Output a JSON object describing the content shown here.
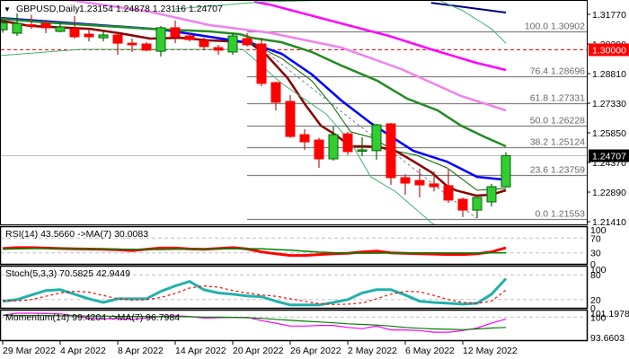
{
  "header": {
    "symbol": "GBPUSD,Daily",
    "ohlc": "1.23154 1.24878 1.23116 1.24707"
  },
  "chart_data": {
    "type": "candlestick",
    "title": "GBPUSD,Daily",
    "ohlc_readout": {
      "open": 1.23154,
      "high": 1.24878,
      "low": 1.23116,
      "close": 1.24707
    },
    "price_axis": {
      "ylim": [
        1.2137,
        1.3249
      ],
      "ticks": [
        "1.31770",
        "1.30290",
        "1.28810",
        "1.27330",
        "1.25850",
        "1.24370",
        "1.22890",
        "1.21410"
      ],
      "tick_values": [
        1.3177,
        1.3029,
        1.2881,
        1.2733,
        1.2585,
        1.2437,
        1.2289,
        1.2141
      ]
    },
    "current_price": {
      "value": 1.24707,
      "label": "1.24707",
      "color": "#000000"
    },
    "key_level": {
      "value": 1.3,
      "label": "1.30000",
      "color": "#FF0000"
    },
    "fibonacci": [
      {
        "label": "100.0 1.30902",
        "value": 1.30902
      },
      {
        "label": "76.4 1.28696",
        "value": 1.28696
      },
      {
        "label": "61.8 1.27331",
        "value": 1.27331
      },
      {
        "label": "50.0 1.26228",
        "value": 1.26228
      },
      {
        "label": "38.2 1.25124",
        "value": 1.25124
      },
      {
        "label": "23.6 1.23759",
        "value": 1.23759
      },
      {
        "label": "0.0 1.21553",
        "value": 1.21553
      }
    ],
    "x_labels": [
      {
        "label": "29 Mar 2022",
        "bar": 0
      },
      {
        "label": "4 Apr 2022",
        "bar": 4
      },
      {
        "label": "8 Apr 2022",
        "bar": 8
      },
      {
        "label": "14 Apr 2022",
        "bar": 12
      },
      {
        "label": "20 Apr 2022",
        "bar": 16
      },
      {
        "label": "26 Apr 2022",
        "bar": 20
      },
      {
        "label": "2 May 2022",
        "bar": 24
      },
      {
        "label": "6 May 2022",
        "bar": 28
      },
      {
        "label": "12 May 2022",
        "bar": 32
      }
    ],
    "candles": [
      [
        1.31,
        1.315,
        1.3085,
        1.3135
      ],
      [
        1.3083,
        1.3181,
        1.3069,
        1.3132
      ],
      [
        1.3125,
        1.3175,
        1.3105,
        1.312
      ],
      [
        1.3132,
        1.315,
        1.3083,
        1.311
      ],
      [
        1.3092,
        1.3137,
        1.3087,
        1.3114
      ],
      [
        1.3105,
        1.3168,
        1.3056,
        1.3065
      ],
      [
        1.3078,
        1.3101,
        1.3042,
        1.3065
      ],
      [
        1.306,
        1.3092,
        1.3042,
        1.3074
      ],
      [
        1.3074,
        1.3083,
        1.2975,
        1.3033
      ],
      [
        1.3033,
        1.3056,
        1.2989,
        1.3025
      ],
      [
        1.3029,
        1.3038,
        1.2993,
        1.2998
      ],
      [
        1.2993,
        1.3119,
        1.2966,
        1.311
      ],
      [
        1.311,
        1.3146,
        1.3033,
        1.3065
      ],
      [
        1.3069,
        1.3083,
        1.3042,
        1.3051
      ],
      [
        1.3047,
        1.306,
        1.2998,
        1.3016
      ],
      [
        1.3011,
        1.3025,
        1.2975,
        1.2998
      ],
      [
        1.2989,
        1.3083,
        1.2975,
        1.3069
      ],
      [
        1.3056,
        1.3083,
        1.3016,
        1.3025
      ],
      [
        1.3029,
        1.306,
        1.2818,
        1.2832
      ],
      [
        1.2836,
        1.284,
        1.2697,
        1.2738
      ],
      [
        1.2742,
        1.2773,
        1.256,
        1.2567
      ],
      [
        1.2576,
        1.2603,
        1.25,
        1.254
      ],
      [
        1.2549,
        1.256,
        1.241,
        1.2455
      ],
      [
        1.2455,
        1.2617,
        1.2446,
        1.2576
      ],
      [
        1.258,
        1.259,
        1.2475,
        1.2491
      ],
      [
        1.2496,
        1.2563,
        1.2468,
        1.25
      ],
      [
        1.2496,
        1.263,
        1.2451,
        1.2625
      ],
      [
        1.263,
        1.2634,
        1.2325,
        1.2361
      ],
      [
        1.2361,
        1.2379,
        1.2276,
        1.2334
      ],
      [
        1.2347,
        1.2406,
        1.2262,
        1.2325
      ],
      [
        1.233,
        1.2392,
        1.2293,
        1.2316
      ],
      [
        1.2321,
        1.2401,
        1.2235,
        1.2249
      ],
      [
        1.2253,
        1.2262,
        1.2164,
        1.2199
      ],
      [
        1.2199,
        1.2262,
        1.2159,
        1.2262
      ],
      [
        1.224,
        1.233,
        1.2217,
        1.2316
      ],
      [
        1.23154,
        1.24878,
        1.23116,
        1.24707
      ]
    ],
    "overlays": [
      {
        "name": "ma-fast-darkred",
        "color": "#8B0000",
        "width": 2.5,
        "points": [
          [
            -0.19,
            1.3146
          ],
          [
            1.87,
            1.3119
          ],
          [
            6.06,
            1.3105
          ],
          [
            8.13,
            1.3083
          ],
          [
            10.25,
            1.3056
          ],
          [
            12.31,
            1.306
          ],
          [
            14.38,
            1.3047
          ],
          [
            17.13,
            1.3038
          ],
          [
            18.38,
            1.2971
          ],
          [
            19.81,
            1.2859
          ],
          [
            21.06,
            1.2724
          ],
          [
            22.13,
            1.2621
          ],
          [
            23.13,
            1.2576
          ],
          [
            24.19,
            1.2518
          ],
          [
            25.25,
            1.2518
          ],
          [
            26.25,
            1.2513
          ],
          [
            27.31,
            1.2495
          ],
          [
            28.38,
            1.2451
          ],
          [
            29.81,
            1.2388
          ],
          [
            30.88,
            1.2321
          ],
          [
            31.5,
            1.2298
          ],
          [
            32.94,
            1.2271
          ],
          [
            34,
            1.2276
          ],
          [
            35,
            1.2298
          ]
        ]
      },
      {
        "name": "ma-blue",
        "color": "#0000FF",
        "width": 2.5,
        "points": [
          [
            -0.19,
            1.3159
          ],
          [
            4,
            1.3137
          ],
          [
            11.06,
            1.3101
          ],
          [
            17.3,
            1.3033
          ],
          [
            19.4,
            1.298
          ],
          [
            21.5,
            1.2877
          ],
          [
            23.56,
            1.2746
          ],
          [
            25.6,
            1.2634
          ],
          [
            27.1,
            1.2563
          ],
          [
            28.56,
            1.2495
          ],
          [
            30.9,
            1.2441
          ],
          [
            33,
            1.2365
          ],
          [
            34.8,
            1.2352
          ]
        ]
      },
      {
        "name": "ma-green",
        "color": "#228B22",
        "width": 2.5,
        "points": [
          [
            -0.19,
            1.3155
          ],
          [
            2.94,
            1.3137
          ],
          [
            6.06,
            1.3123
          ],
          [
            10.25,
            1.3105
          ],
          [
            14.38,
            1.3092
          ],
          [
            16.5,
            1.3078
          ],
          [
            17.31,
            1.306
          ],
          [
            19.38,
            1.3038
          ],
          [
            21.5,
            1.2989
          ],
          [
            23.56,
            1.2921
          ],
          [
            26.06,
            1.2845
          ],
          [
            28.13,
            1.2756
          ],
          [
            30.25,
            1.2697
          ],
          [
            31.88,
            1.2621
          ],
          [
            33.56,
            1.2563
          ],
          [
            35,
            1.2518
          ]
        ]
      },
      {
        "name": "ma-violet",
        "color": "#EE82EE",
        "width": 2.5,
        "points": [
          [
            -0.19,
            1.335
          ],
          [
            4.63,
            1.3249
          ],
          [
            10.25,
            1.319
          ],
          [
            14.38,
            1.3123
          ],
          [
            18.56,
            1.3085
          ],
          [
            23.56,
            1.3011
          ],
          [
            27.75,
            1.2903
          ],
          [
            31.88,
            1.2769
          ],
          [
            35,
            1.2697
          ]
        ]
      },
      {
        "name": "ma-magenta",
        "color": "#FF00FF",
        "width": 2.5,
        "points": [
          [
            17.5,
            1.324
          ],
          [
            18.56,
            1.3226
          ],
          [
            26.88,
            1.3069
          ],
          [
            29.81,
            1.3002
          ],
          [
            32.94,
            1.2935
          ],
          [
            35,
            1.2899
          ]
        ]
      },
      {
        "name": "ma-navy",
        "color": "#000080",
        "width": 2,
        "points": [
          [
            29.8,
            1.3235
          ],
          [
            35,
            1.3186
          ]
        ]
      },
      {
        "name": "ma-thin-green",
        "color": "#006400",
        "width": 1,
        "points": [
          [
            17.3,
            1.3033
          ],
          [
            19.4,
            1.2957
          ],
          [
            21.5,
            1.2845
          ],
          [
            22.9,
            1.2724
          ],
          [
            24.2,
            1.259
          ],
          [
            25.6,
            1.2563
          ],
          [
            27.3,
            1.2495
          ],
          [
            28.8,
            1.2473
          ],
          [
            30.9,
            1.241
          ],
          [
            33,
            1.2298
          ],
          [
            35,
            1.2307
          ]
        ]
      },
      {
        "name": "band-upper",
        "color": "#3CB371",
        "width": 1,
        "points": [
          [
            12,
            1.3204
          ],
          [
            18,
            1.324
          ],
          [
            30,
            1.326
          ],
          [
            32,
            1.3195
          ],
          [
            34,
            1.3105
          ],
          [
            35,
            1.3033
          ]
        ]
      },
      {
        "name": "band-lower",
        "color": "#3CB371",
        "width": 1,
        "points": [
          [
            -0.19,
            1.2971
          ],
          [
            5.4,
            1.3002
          ],
          [
            16.7,
            1.3002
          ],
          [
            17.3,
            1.2966
          ],
          [
            19.4,
            1.2832
          ],
          [
            22.5,
            1.2679
          ],
          [
            24.2,
            1.254
          ],
          [
            25.6,
            1.2365
          ],
          [
            27.3,
            1.2293
          ],
          [
            29.8,
            1.2137
          ],
          [
            31,
            1.208
          ]
        ]
      },
      {
        "name": "trend-dotted",
        "color": "#708090",
        "width": 1,
        "dash": "3,3",
        "points": [
          [
            17.3,
            1.3047
          ],
          [
            32.94,
            1.2159
          ]
        ]
      }
    ],
    "indicators": [
      {
        "name": "rsi",
        "label": "RSI(14) 43.5660  ->MA(7) 30.0083",
        "ylim": [
          0,
          100
        ],
        "levels": [
          70,
          30
        ],
        "ticks": [
          "100",
          "70",
          "30",
          "0"
        ],
        "tick_values": [
          100,
          70,
          30,
          0
        ],
        "series": [
          {
            "name": "RSI(14)",
            "color": "#FF0000",
            "width": 3,
            "values": [
              41.8,
              44.1,
              44.1,
              43,
              41.8,
              41,
              40.3,
              39.4,
              38.2,
              35.9,
              39.4,
              43,
              43,
              40.6,
              39.4,
              41.8,
              44.1,
              40.6,
              32.4,
              27.6,
              22.9,
              22.9,
              25.3,
              27.6,
              28.8,
              32.4,
              34.7,
              30,
              28.8,
              27.6,
              26.5,
              25.3,
              25.3,
              27.6,
              32.4,
              43.566
            ]
          },
          {
            "name": "MA(7)",
            "color": "#008000",
            "width": 1.5,
            "values": [
              40,
              41,
              41.5,
              42,
              42,
              41.5,
              41,
              40.5,
              40,
              39.5,
              39,
              39,
              39.5,
              40,
              40,
              40.5,
              41,
              41.5,
              41,
              39,
              37,
              34.5,
              32,
              30.5,
              30,
              29,
              29,
              29.5,
              30,
              30,
              29.8,
              29.5,
              29.5,
              29.6,
              29.8,
              30.0083
            ]
          }
        ]
      },
      {
        "name": "stochastic",
        "label": "Stoch(5,3,3) 70.5825 42.9449",
        "ylim": [
          0,
          100
        ],
        "levels": [
          80,
          20
        ],
        "ticks": [
          "100",
          "80",
          "20",
          "0"
        ],
        "tick_values": [
          100,
          80,
          20,
          0
        ],
        "series": [
          {
            "name": "%K",
            "color": "#20B2AA",
            "width": 3,
            "values": [
              15.6,
              20,
              31,
              42,
              44,
              33,
              22,
              13,
              22,
              22,
              22,
              40,
              53,
              64,
              44,
              36,
              33,
              29,
              27,
              16,
              7,
              7,
              7,
              13,
              20,
              36,
              44,
              44,
              31,
              16,
              13,
              11,
              9,
              11,
              33,
              70.5825
            ]
          },
          {
            "name": "%D",
            "color": "#FF0000",
            "width": 1.2,
            "dash": "3,3",
            "values": [
              18,
              17,
              20,
              28,
              36,
              40,
              38,
              30,
              22,
              19,
              20,
              25,
              35,
              48,
              53,
              50,
              42,
              36,
              31,
              28,
              22,
              16,
              10,
              8,
              9,
              12,
              22,
              33,
              40,
              39,
              30,
              20,
              13,
              11,
              16,
              42.9449
            ]
          }
        ]
      },
      {
        "name": "momentum",
        "label": "Momentum(14) 99.4204  ->MA(7) 96.7984",
        "ylim": [
          93.6603,
          101.1978
        ],
        "levels": [
          100
        ],
        "ticks": [
          "101.1978",
          "100",
          "93.6603"
        ],
        "tick_values": [
          101.1978,
          100,
          93.6603
        ],
        "series": [
          {
            "name": "Momentum(14)",
            "color": "#FF00FF",
            "width": 1.2,
            "values": [
              100.57,
              101.2,
              101.2,
              101.1,
              101.0,
              100.4,
              99.7,
              99.5,
              99.5,
              99.3,
              99.7,
              100.2,
              100.4,
              100.2,
              99.7,
              99.8,
              99.9,
              99.9,
              98.9,
              98.1,
              97.2,
              97.2,
              97.4,
              97.4,
              96.8,
              96.4,
              97.2,
              96.0,
              96.0,
              95.8,
              95.3,
              95.3,
              95.8,
              96.6,
              98.1,
              99.4204
            ]
          },
          {
            "name": "MA(7)",
            "color": "#008000",
            "width": 1.2,
            "values": [
              100.5,
              100.5,
              100.5,
              100.5,
              100.4,
              100.4,
              100.3,
              100.3,
              100.2,
              100.2,
              100.2,
              100.1,
              100.1,
              100.1,
              100.0,
              100.0,
              99.9,
              99.8,
              99.6,
              99.3,
              99.0,
              98.7,
              98.5,
              98.2,
              97.9,
              97.7,
              97.5,
              97.2,
              96.8,
              96.5,
              96.3,
              96.2,
              96.1,
              96.3,
              96.6,
              96.7984
            ]
          }
        ]
      }
    ],
    "colors": {
      "bull": "#32CD32",
      "bull_edge": "#006400",
      "bear": "#FF0000",
      "bear_edge": "#B22222",
      "fib": "#808080",
      "grid_dash": "#C0C0C0"
    }
  }
}
